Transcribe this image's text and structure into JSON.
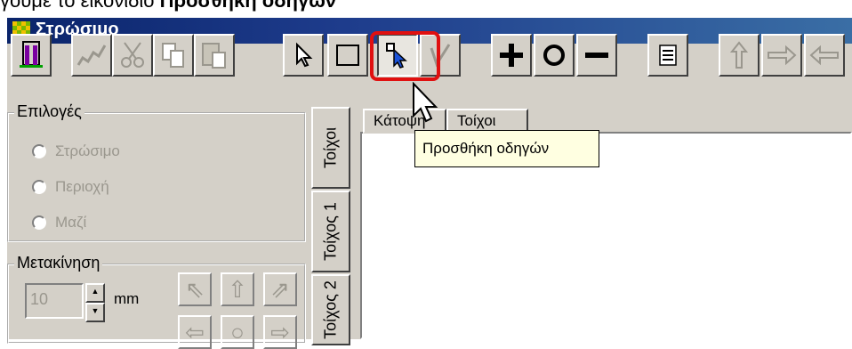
{
  "caption": {
    "prefix": "γούμε το εικονίδιο ",
    "bold": "Προσθήκη οδηγών"
  },
  "window": {
    "title": "Στρώσιμο"
  },
  "toolbar": {
    "buttons": [
      {
        "name": "exit-icon",
        "state": "normal"
      },
      {
        "name": "draw-icon",
        "state": "disabled"
      },
      {
        "name": "cut-icon",
        "state": "disabled"
      },
      {
        "name": "copy-icon",
        "state": "disabled"
      },
      {
        "name": "paste-icon",
        "state": "disabled"
      },
      {
        "name": "pointer-icon",
        "state": "normal"
      },
      {
        "name": "rectangle-icon",
        "state": "normal"
      },
      {
        "name": "add-guides-icon",
        "state": "pressed"
      },
      {
        "name": "check-icon",
        "state": "disabled"
      },
      {
        "name": "plus-icon",
        "state": "normal"
      },
      {
        "name": "circle-icon",
        "state": "normal"
      },
      {
        "name": "minus-icon",
        "state": "normal"
      },
      {
        "name": "list-icon",
        "state": "normal"
      },
      {
        "name": "up-arrow-icon",
        "state": "disabled"
      },
      {
        "name": "right-arrow-icon",
        "state": "disabled"
      },
      {
        "name": "left-arrow-icon",
        "state": "disabled"
      }
    ],
    "highlight_color": "#e01010"
  },
  "tooltip": "Προσθήκη οδηγών",
  "options": {
    "label": "Επιλογές",
    "items": [
      "Στρώσιμο",
      "Περιοχή",
      "Μαζί"
    ]
  },
  "movement": {
    "label": "Μετακίνηση",
    "value": "10",
    "unit": "mm"
  },
  "vertical_tabs": [
    "Τοίχοι",
    "Τοίχος 1",
    "Τοίχος 2"
  ],
  "top_tabs": [
    "Κάτοψη",
    "Τοίχοι"
  ]
}
